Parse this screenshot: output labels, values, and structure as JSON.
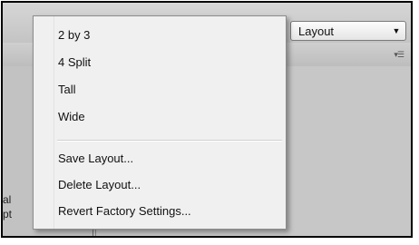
{
  "toolbar": {
    "layout_dropdown": {
      "selected": "Layout",
      "chevron_icon": "chevron-down-icon"
    }
  },
  "panel": {
    "menu_icon": "panel-options-icon"
  },
  "left_panel": {
    "partial_labels": [
      "al",
      "pt"
    ]
  },
  "layout_menu": {
    "items": [
      {
        "label": "2 by 3"
      },
      {
        "label": "4 Split"
      },
      {
        "label": "Tall"
      },
      {
        "label": "Wide"
      }
    ],
    "actions": [
      {
        "label": "Save Layout..."
      },
      {
        "label": "Delete Layout..."
      },
      {
        "label": "Revert Factory Settings..."
      }
    ]
  }
}
